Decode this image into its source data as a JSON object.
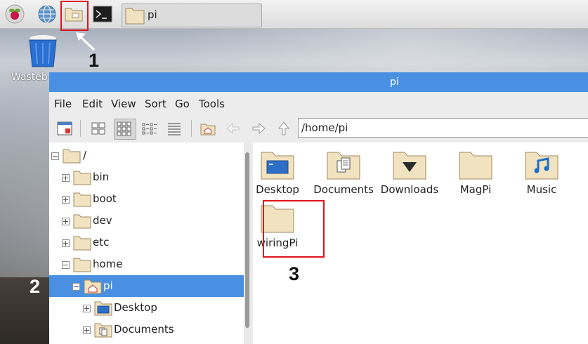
{
  "panel": {
    "task_label": "pi"
  },
  "desktop": {
    "trash_label": "Wasteb"
  },
  "annotations": {
    "one": "1",
    "two": "2",
    "three": "3"
  },
  "window": {
    "title": "pi",
    "menu": [
      "File",
      "Edit",
      "View",
      "Sort",
      "Go",
      "Tools"
    ],
    "path": "/home/pi"
  },
  "tree": [
    {
      "name": "/",
      "expander": "minus",
      "level": 0
    },
    {
      "name": "bin",
      "expander": "plus",
      "level": 1
    },
    {
      "name": "boot",
      "expander": "plus",
      "level": 1
    },
    {
      "name": "dev",
      "expander": "plus",
      "level": 1
    },
    {
      "name": "etc",
      "expander": "plus",
      "level": 1
    },
    {
      "name": "home",
      "expander": "minus",
      "level": 1
    },
    {
      "name": "pi",
      "expander": "minus",
      "level": 2,
      "selected": true
    },
    {
      "name": "Desktop",
      "expander": "plus",
      "level": 3
    },
    {
      "name": "Documents",
      "expander": "plus",
      "level": 3
    }
  ],
  "files": [
    {
      "name": "Desktop",
      "icon": "desktop-folder-icon"
    },
    {
      "name": "Documents",
      "icon": "documents-folder-icon"
    },
    {
      "name": "Downloads",
      "icon": "downloads-folder-icon"
    },
    {
      "name": "MagPi",
      "icon": "folder-icon"
    },
    {
      "name": "Music",
      "icon": "music-folder-icon"
    },
    {
      "name": "wiringPi",
      "icon": "folder-icon"
    }
  ],
  "colors": {
    "accent": "#4a90e2",
    "annotation_red": "#e0141c"
  }
}
